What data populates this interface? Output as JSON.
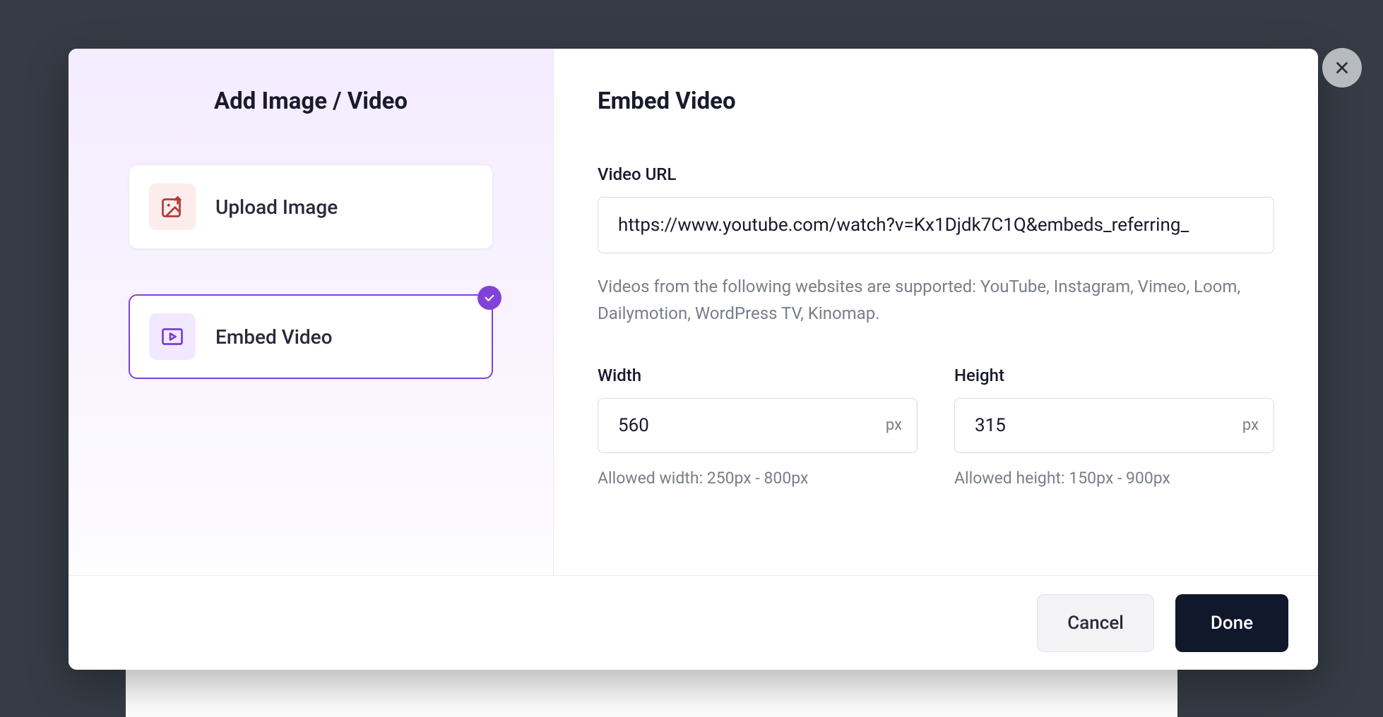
{
  "sidebar": {
    "title": "Add Image / Video",
    "options": [
      {
        "label": "Upload Image"
      },
      {
        "label": "Embed Video"
      }
    ]
  },
  "main": {
    "title": "Embed Video",
    "url_label": "Video URL",
    "url_value": "https://www.youtube.com/watch?v=Kx1Djdk7C1Q&embeds_referring_",
    "url_help": "Videos from the following websites are supported: YouTube, Instagram, Vimeo, Loom, Dailymotion, WordPress TV, Kinomap.",
    "width_label": "Width",
    "width_value": "560",
    "width_unit": "px",
    "width_hint": "Allowed width: 250px - 800px",
    "height_label": "Height",
    "height_value": "315",
    "height_unit": "px",
    "height_hint": "Allowed height: 150px - 900px"
  },
  "footer": {
    "cancel": "Cancel",
    "done": "Done"
  }
}
